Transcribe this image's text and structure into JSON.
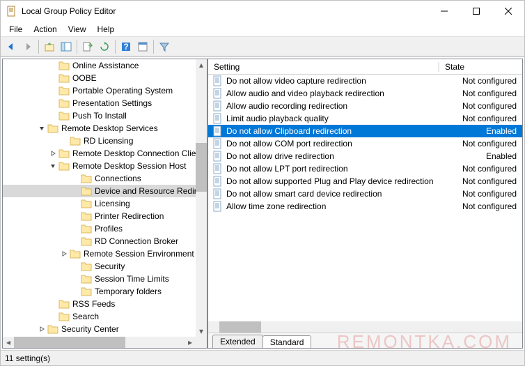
{
  "window": {
    "title": "Local Group Policy Editor"
  },
  "menu": {
    "file": "File",
    "action": "Action",
    "view": "View",
    "help": "Help"
  },
  "tree": {
    "items": [
      {
        "indent": 4,
        "tw": "",
        "label": "Online Assistance"
      },
      {
        "indent": 4,
        "tw": "",
        "label": "OOBE"
      },
      {
        "indent": 4,
        "tw": "",
        "label": "Portable Operating System"
      },
      {
        "indent": 4,
        "tw": "",
        "label": "Presentation Settings"
      },
      {
        "indent": 4,
        "tw": "",
        "label": "Push To Install"
      },
      {
        "indent": 3,
        "tw": "open",
        "label": "Remote Desktop Services"
      },
      {
        "indent": 5,
        "tw": "",
        "label": "RD Licensing"
      },
      {
        "indent": 4,
        "tw": "closed",
        "label": "Remote Desktop Connection Client"
      },
      {
        "indent": 4,
        "tw": "open",
        "label": "Remote Desktop Session Host"
      },
      {
        "indent": 6,
        "tw": "",
        "label": "Connections"
      },
      {
        "indent": 6,
        "tw": "",
        "label": "Device and Resource Redirection",
        "selected": true
      },
      {
        "indent": 6,
        "tw": "",
        "label": "Licensing"
      },
      {
        "indent": 6,
        "tw": "",
        "label": "Printer Redirection"
      },
      {
        "indent": 6,
        "tw": "",
        "label": "Profiles"
      },
      {
        "indent": 6,
        "tw": "",
        "label": "RD Connection Broker"
      },
      {
        "indent": 5,
        "tw": "closed",
        "label": "Remote Session Environment"
      },
      {
        "indent": 6,
        "tw": "",
        "label": "Security"
      },
      {
        "indent": 6,
        "tw": "",
        "label": "Session Time Limits"
      },
      {
        "indent": 6,
        "tw": "",
        "label": "Temporary folders"
      },
      {
        "indent": 4,
        "tw": "",
        "label": "RSS Feeds"
      },
      {
        "indent": 4,
        "tw": "",
        "label": "Search"
      },
      {
        "indent": 3,
        "tw": "closed",
        "label": "Security Center"
      }
    ]
  },
  "list": {
    "headers": {
      "setting": "Setting",
      "state": "State"
    },
    "rows": [
      {
        "setting": "Do not allow video capture redirection",
        "state": "Not configured"
      },
      {
        "setting": "Allow audio and video playback redirection",
        "state": "Not configured"
      },
      {
        "setting": "Allow audio recording redirection",
        "state": "Not configured"
      },
      {
        "setting": "Limit audio playback quality",
        "state": "Not configured"
      },
      {
        "setting": "Do not allow Clipboard redirection",
        "state": "Enabled",
        "selected": true
      },
      {
        "setting": "Do not allow COM port redirection",
        "state": "Not configured"
      },
      {
        "setting": "Do not allow drive redirection",
        "state": "Enabled"
      },
      {
        "setting": "Do not allow LPT port redirection",
        "state": "Not configured"
      },
      {
        "setting": "Do not allow supported Plug and Play device redirection",
        "state": "Not configured"
      },
      {
        "setting": "Do not allow smart card device redirection",
        "state": "Not configured"
      },
      {
        "setting": "Allow time zone redirection",
        "state": "Not configured"
      }
    ]
  },
  "tabs": {
    "extended": "Extended",
    "standard": "Standard"
  },
  "status": {
    "count": "11 setting(s)"
  },
  "watermark": "REMONTKA.COM"
}
